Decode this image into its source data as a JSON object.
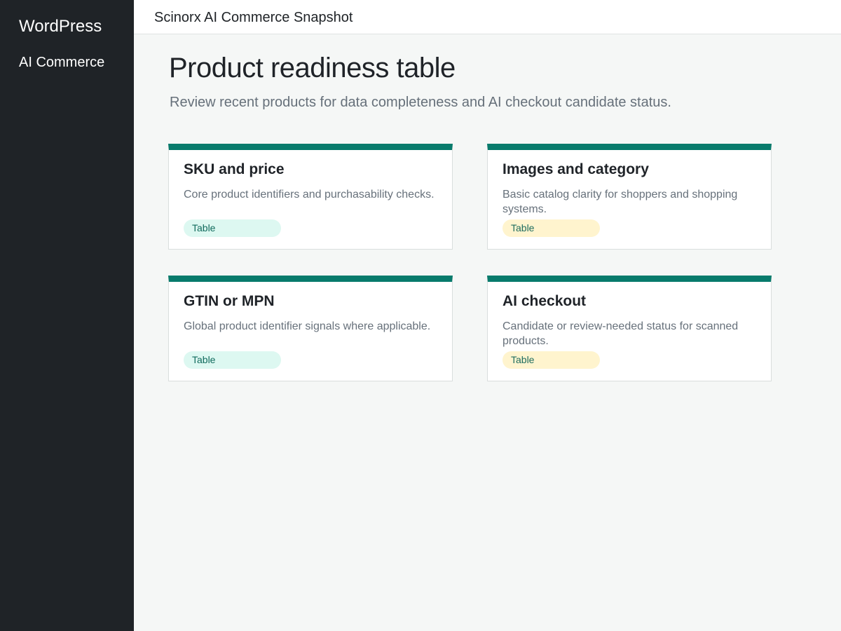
{
  "sidebar": {
    "brand": "WordPress",
    "items": [
      {
        "label": "AI Commerce"
      }
    ]
  },
  "topbar": {
    "title": "Scinorx AI Commerce Snapshot"
  },
  "page": {
    "title": "Product readiness table",
    "subtitle": "Review recent products for data completeness and AI checkout candidate status."
  },
  "cards": [
    {
      "title": "SKU and price",
      "description": "Core product identifiers and purchasability checks.",
      "badge": "Table",
      "badge_color": "#ddf8f1"
    },
    {
      "title": "Images and category",
      "description": "Basic catalog clarity for shoppers and shopping systems.",
      "badge": "Table",
      "badge_color": "#fff4ce"
    },
    {
      "title": "GTIN or MPN",
      "description": "Global product identifier signals where applicable.",
      "badge": "Table",
      "badge_color": "#ddf8f1"
    },
    {
      "title": "AI checkout",
      "description": "Candidate or review-needed status for scanned products.",
      "badge": "Table",
      "badge_color": "#fff4ce"
    }
  ],
  "colors": {
    "sidebar_background": "#1f2327",
    "accent": "#087b6c",
    "page_background": "#f5f7f6",
    "card_border": "#d9dedd"
  }
}
